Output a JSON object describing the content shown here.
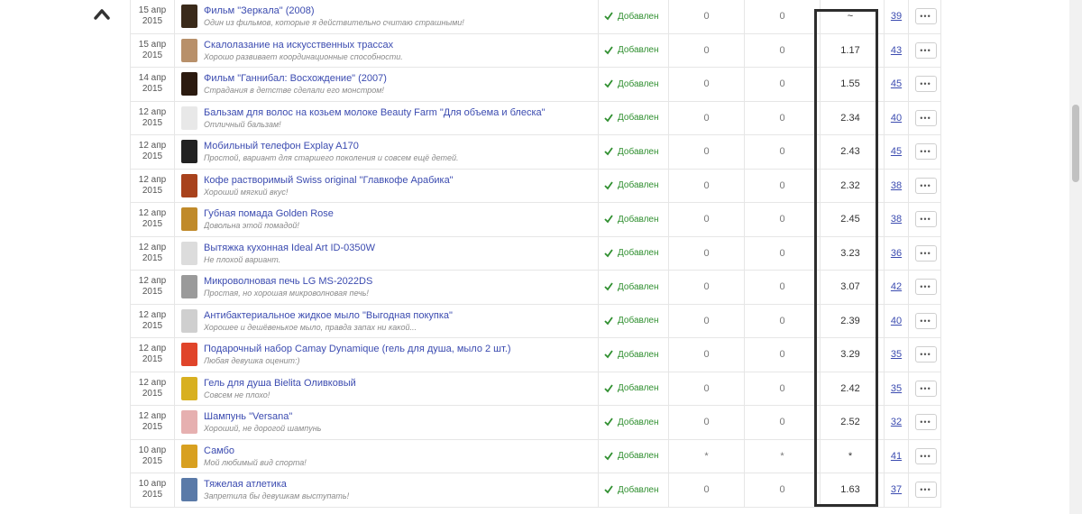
{
  "status_label": "Добавлен",
  "more_label": "•••",
  "rows": [
    {
      "date_day": "15 апр",
      "date_year": "2015",
      "title": "Фильм \"Зеркала\" (2008)",
      "subtitle": "Один из фильмов, которые я действительно считаю страшными!",
      "n1": "0",
      "n2": "0",
      "score": "~",
      "link": "39",
      "thumb_color": "#3a2a1a"
    },
    {
      "date_day": "15 апр",
      "date_year": "2015",
      "title": "Скалолазание на искусственных трассах",
      "subtitle": "Хорошо развивает координационные способности.",
      "n1": "0",
      "n2": "0",
      "score": "1.17",
      "link": "43",
      "thumb_color": "#b8906a"
    },
    {
      "date_day": "14 апр",
      "date_year": "2015",
      "title": "Фильм \"Ганнибал: Восхождение\" (2007)",
      "subtitle": "Страдания в детстве сделали его монстром!",
      "n1": "0",
      "n2": "0",
      "score": "1.55",
      "link": "45",
      "thumb_color": "#2b1a0f"
    },
    {
      "date_day": "12 апр",
      "date_year": "2015",
      "title": "Бальзам для волос на козьем молоке Beauty Farm \"Для объема и блеска\"",
      "subtitle": "Отличный бальзам!",
      "n1": "0",
      "n2": "0",
      "score": "2.34",
      "link": "40",
      "thumb_color": "#e8e8e8"
    },
    {
      "date_day": "12 апр",
      "date_year": "2015",
      "title": "Мобильный телефон Explay A170",
      "subtitle": "Простой, вариант для старшего поколения и совсем ещё детей.",
      "n1": "0",
      "n2": "0",
      "score": "2.43",
      "link": "45",
      "thumb_color": "#222222"
    },
    {
      "date_day": "12 апр",
      "date_year": "2015",
      "title": "Кофе растворимый Swiss original \"Главкофе Арабика\"",
      "subtitle": "Хороший мягкий вкус!",
      "n1": "0",
      "n2": "0",
      "score": "2.32",
      "link": "38",
      "thumb_color": "#a8421c"
    },
    {
      "date_day": "12 апр",
      "date_year": "2015",
      "title": "Губная помада Golden Rose",
      "subtitle": "Довольна этой помадой!",
      "n1": "0",
      "n2": "0",
      "score": "2.45",
      "link": "38",
      "thumb_color": "#c08a2a"
    },
    {
      "date_day": "12 апр",
      "date_year": "2015",
      "title": "Вытяжка кухонная Ideal Art ID-0350W",
      "subtitle": "Не плохой вариант.",
      "n1": "0",
      "n2": "0",
      "score": "3.23",
      "link": "36",
      "thumb_color": "#dcdcdc"
    },
    {
      "date_day": "12 апр",
      "date_year": "2015",
      "title": "Микроволновая печь LG MS-2022DS",
      "subtitle": "Простая, но хорошая микроволновая печь!",
      "n1": "0",
      "n2": "0",
      "score": "3.07",
      "link": "42",
      "thumb_color": "#9a9a9a"
    },
    {
      "date_day": "12 апр",
      "date_year": "2015",
      "title": "Антибактериальное жидкое мыло \"Выгодная покупка\"",
      "subtitle": "Хорошее и дешёвенькое мыло, правда запах ни какой...",
      "n1": "0",
      "n2": "0",
      "score": "2.39",
      "link": "40",
      "thumb_color": "#cfcfcf"
    },
    {
      "date_day": "12 апр",
      "date_year": "2015",
      "title": "Подарочный набор Camay Dynamique (гель для душа, мыло 2 шт.)",
      "subtitle": "Любая девушка оценит:)",
      "n1": "0",
      "n2": "0",
      "score": "3.29",
      "link": "35",
      "thumb_color": "#e0442a"
    },
    {
      "date_day": "12 апр",
      "date_year": "2015",
      "title": "Гель для душа Bielita Оливковый",
      "subtitle": "Совсем не плохо!",
      "n1": "0",
      "n2": "0",
      "score": "2.42",
      "link": "35",
      "thumb_color": "#d8b020"
    },
    {
      "date_day": "12 апр",
      "date_year": "2015",
      "title": "Шампунь \"Versana\"",
      "subtitle": "Хороший, не дорогой шампунь",
      "n1": "0",
      "n2": "0",
      "score": "2.52",
      "link": "32",
      "thumb_color": "#e6b0b0"
    },
    {
      "date_day": "10 апр",
      "date_year": "2015",
      "title": "Самбо",
      "subtitle": "Мой любимый вид спорта!",
      "n1": "*",
      "n2": "*",
      "score": "*",
      "link": "41",
      "thumb_color": "#d8a020"
    },
    {
      "date_day": "10 апр",
      "date_year": "2015",
      "title": "Тяжелая атлетика",
      "subtitle": "Запретила бы девушкам выступать!",
      "n1": "0",
      "n2": "0",
      "score": "1.63",
      "link": "37",
      "thumb_color": "#5a7aa8"
    }
  ]
}
